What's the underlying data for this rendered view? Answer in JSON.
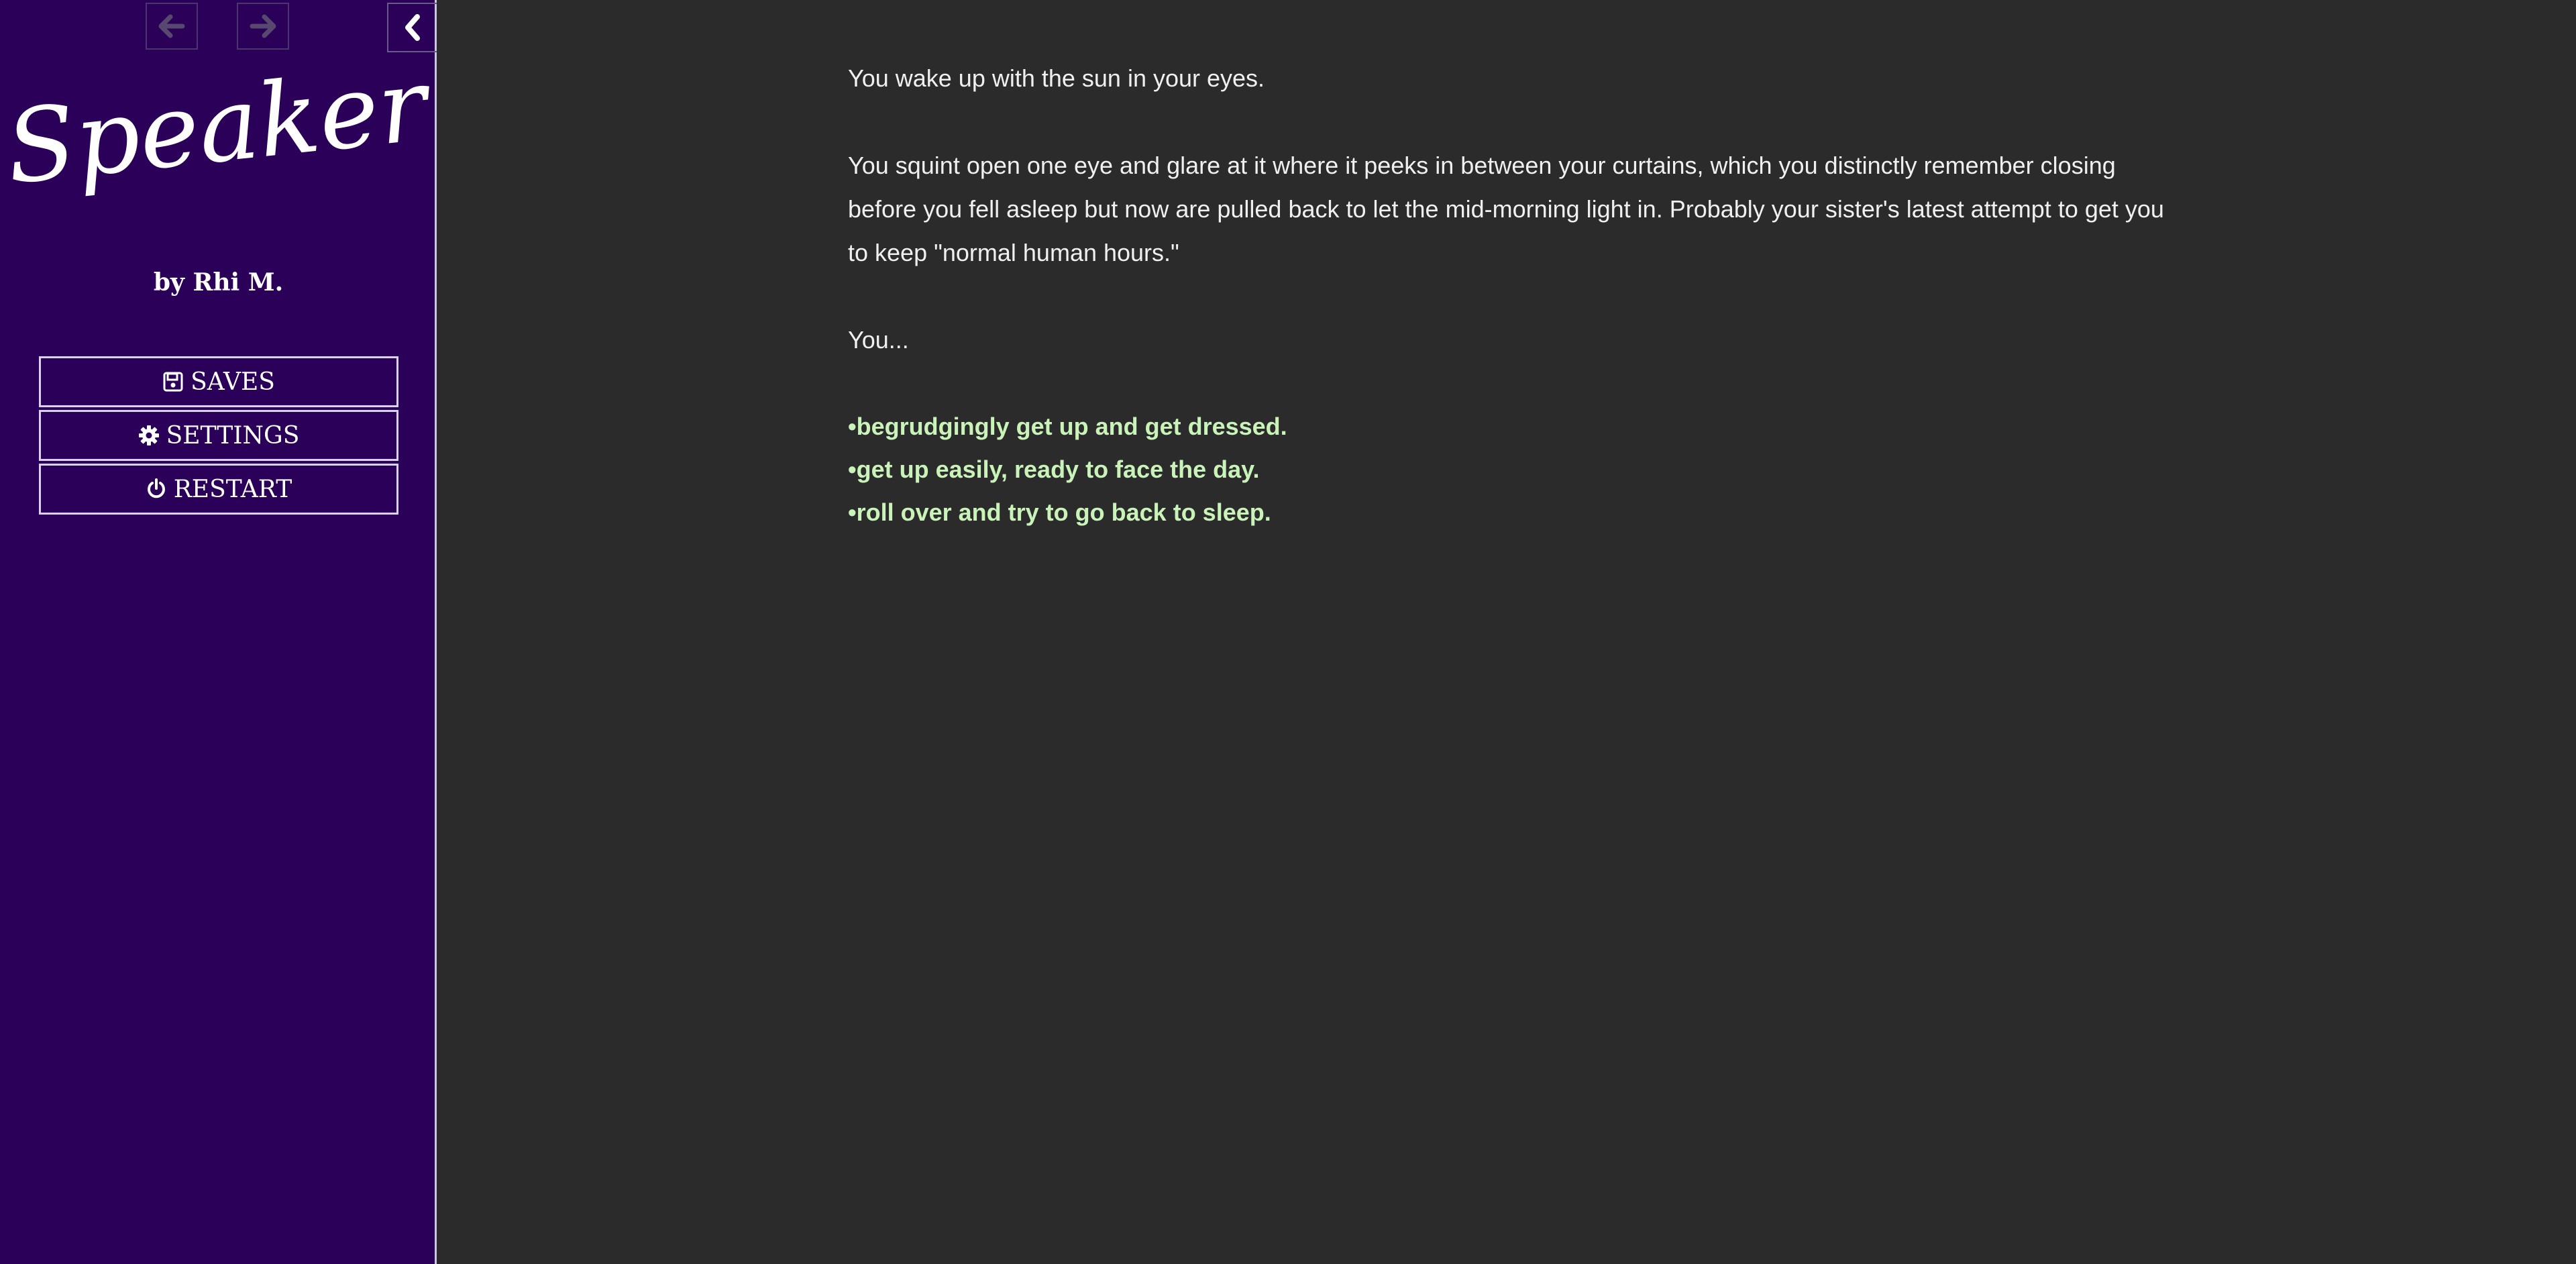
{
  "sidebar": {
    "title": "Speaker",
    "author": "by Rhi M.",
    "menu": [
      {
        "label": "SAVES",
        "icon": "save-icon"
      },
      {
        "label": "SETTINGS",
        "icon": "gear-icon"
      },
      {
        "label": "RESTART",
        "icon": "power-icon"
      }
    ]
  },
  "passage": {
    "paragraphs": [
      "You wake up with the sun in your eyes.",
      "You squint open one eye and glare at it where it peeks in between your curtains, which you distinctly remember closing before you fell asleep but now are pulled back to let the mid-morning light in. Probably your sister's latest attempt to get you to keep \"normal human hours.\"",
      "You..."
    ],
    "choices": [
      "•begrudgingly get up and get dressed.",
      "•get up easily, ready to face the day.",
      "•roll over and try to go back to sleep."
    ]
  },
  "colors": {
    "sidebar_bg": "#2a0058",
    "page_bg": "#2b2b2b",
    "choice_text": "#c9f3b8"
  }
}
